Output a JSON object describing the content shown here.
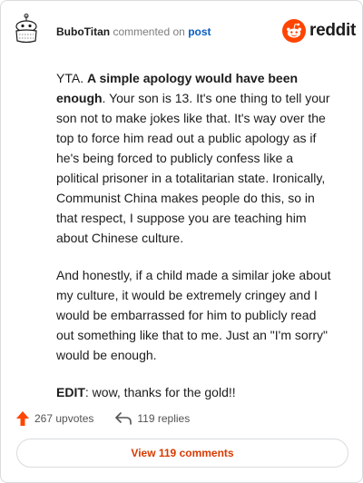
{
  "header": {
    "username": "BuboTitan",
    "action_text": "commented on",
    "target_link": "post",
    "brand": "reddit"
  },
  "comment": {
    "p1_lead": "YTA. ",
    "p1_bold1": "A simple apology would have been",
    "p1_bold2": "enough",
    "p1_lines": [
      ". Your son is 13. It's one thing to tell your",
      "son not to make jokes like that. It's way over the",
      "top to force him read out a public apology as if",
      "he's being forced to publicly confess like a",
      "political prisoner in a totalitarian state. Ironically,",
      "Communist China makes people do this, so in",
      "that respect, I suppose you are teaching him",
      "about Chinese culture."
    ],
    "p2_lines": [
      "And honestly, if a child made a similar joke about",
      "my culture, it would be extremely cringey and I",
      "would be embarrassed for him to publicly read",
      "out something like that to me. Just an \"I'm sorry\"",
      "would be enough."
    ],
    "p3_bold": "EDIT",
    "p3_rest": ": wow, thanks for the gold!!"
  },
  "actions": {
    "upvotes": "267 upvotes",
    "replies": "119 replies"
  },
  "view_button": "View 119 comments",
  "colors": {
    "upvote": "#ff4500",
    "link": "#0a5cc2",
    "button_text": "#d93a00"
  }
}
